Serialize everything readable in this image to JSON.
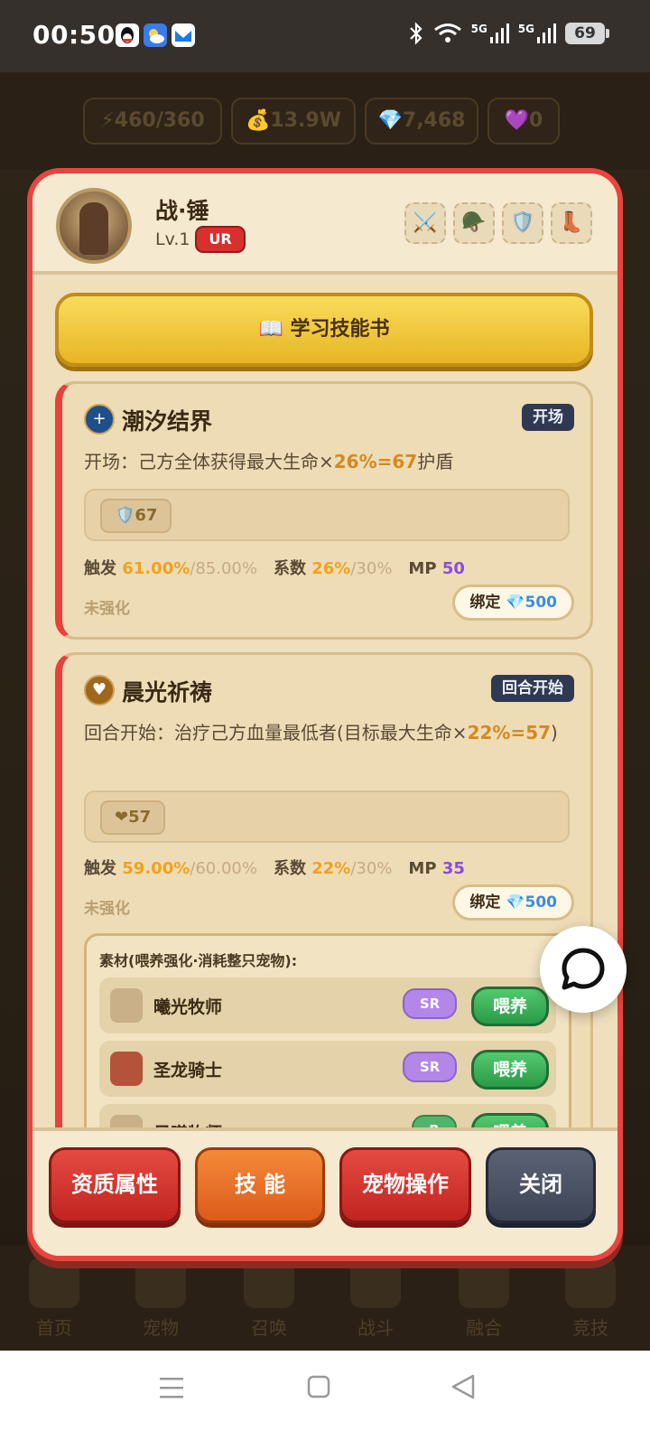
{
  "status_bar": {
    "time": "00:50",
    "battery": "69",
    "signal1": "5G",
    "signal2": "5G"
  },
  "resources": [
    "⚡460/360",
    "💰13.9W",
    "💎7,468",
    "💜0"
  ],
  "bottom_nav": [
    "首页",
    "宠物",
    "召唤",
    "战斗",
    "融合",
    "竞技"
  ],
  "pet": {
    "name": "战·锤",
    "level": "Lv.1",
    "rarity": "UR"
  },
  "equipment_slots": [
    "⚔️",
    "🪖",
    "🛡️",
    "👢"
  ],
  "learn_button": "📖 学习技能书",
  "skills": [
    {
      "name": "潮汐结界",
      "tag": "开场",
      "desc_pre": "开场：己方全体获得最大生命×",
      "desc_hl": "26%=67",
      "desc_post": "护盾",
      "effect_chip": "🛡️67",
      "trigger_label": "触发",
      "trigger_val": "61.00%",
      "trigger_max": "/85.00%",
      "coef_label": "系数",
      "coef_val": "26%",
      "coef_max": "/30%",
      "mp_label": "MP",
      "mp_val": "50",
      "status": "未强化",
      "bind_label": "绑定",
      "bind_cost": "💎500"
    },
    {
      "name": "晨光祈祷",
      "tag": "回合开始",
      "desc_pre": "回合开始：治疗己方血量最低者(目标最大生命×",
      "desc_hl": "22%=57",
      "desc_post": ")",
      "effect_chip": "❤57",
      "trigger_label": "触发",
      "trigger_val": "59.00%",
      "trigger_max": "/60.00%",
      "coef_label": "系数",
      "coef_val": "22%",
      "coef_max": "/30%",
      "mp_label": "MP",
      "mp_val": "35",
      "status": "未强化",
      "bind_label": "绑定",
      "bind_cost": "💎500"
    }
  ],
  "materials": {
    "title": "素材(喂养强化·消耗整只宠物):",
    "items": [
      {
        "name": "曦光牧师",
        "rarity": "SR",
        "action": "喂养"
      },
      {
        "name": "圣龙骑士",
        "rarity": "SR",
        "action": "喂养"
      },
      {
        "name": "晨曦牧师",
        "rarity": "R",
        "action": "喂养"
      }
    ]
  },
  "footer_buttons": [
    "资质属性",
    "技 能",
    "宠物操作",
    "关闭"
  ],
  "colors": {
    "accent_red": "#e8453e",
    "gold": "#f0a21e",
    "mp_purple": "#8a4ce0"
  }
}
